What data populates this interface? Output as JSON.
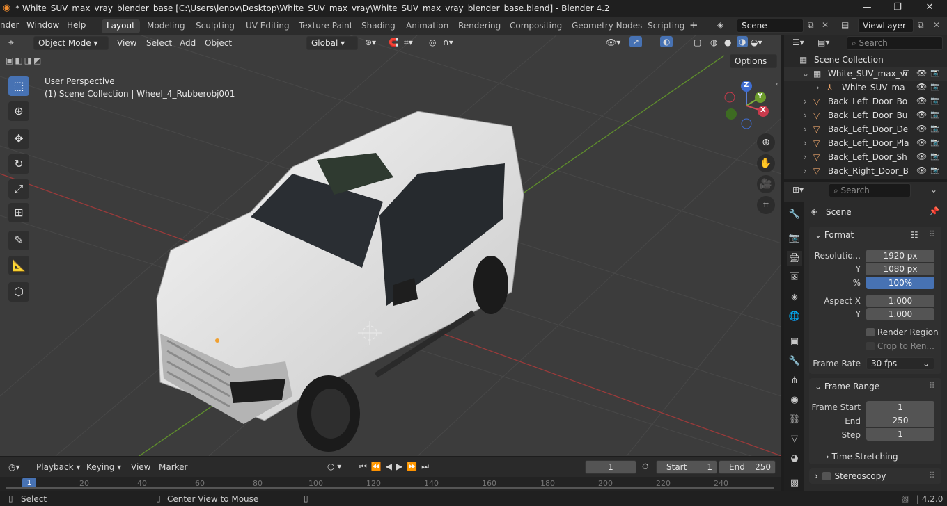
{
  "window": {
    "title": "* White_SUV_max_vray_blender_base [C:\\Users\\lenov\\Desktop\\White_SUV_max_vray\\White_SUV_max_vray_blender_base.blend] - Blender 4.2",
    "min": "—",
    "max": "❐",
    "close": "✕"
  },
  "menus": [
    "nder",
    "Window",
    "Help"
  ],
  "workspaces": [
    "Layout",
    "Modeling",
    "Sculpting",
    "UV Editing",
    "Texture Paint",
    "Shading",
    "Animation",
    "Rendering",
    "Compositing",
    "Geometry Nodes",
    "Scripting"
  ],
  "scene": {
    "name": "Scene",
    "viewlayer": "ViewLayer"
  },
  "viewport_header": {
    "mode": "Object Mode",
    "menus": [
      "View",
      "Select",
      "Add",
      "Object"
    ],
    "orientation": "Global",
    "options": "Options"
  },
  "viewport_info": {
    "perspective": "User Perspective",
    "collection": "(1) Scene Collection | Wheel_4_Rubberobj001"
  },
  "gizmo": {
    "z": "Z",
    "y": "Y",
    "x": "X"
  },
  "outliner": {
    "search_placeholder": "Search",
    "root": "Scene Collection",
    "items": [
      "White_SUV_max_vr",
      "White_SUV_ma",
      "Back_Left_Door_Bo",
      "Back_Left_Door_Bu",
      "Back_Left_Door_De",
      "Back_Left_Door_Pla",
      "Back_Left_Door_Sh",
      "Back_Right_Door_B"
    ]
  },
  "properties": {
    "search_placeholder": "Search",
    "context": "Scene",
    "format": {
      "title": "Format",
      "res_label": "Resolutio...",
      "res_x": "1920 px",
      "y_label": "Y",
      "res_y": "1080 px",
      "pct_label": "%",
      "pct": "100%",
      "aspect_label": "Aspect X",
      "aspect_x": "1.000",
      "aspect_y_label": "Y",
      "aspect_y": "1.000",
      "render_region": "Render Region",
      "crop": "Crop to Ren...",
      "framerate_label": "Frame Rate",
      "framerate": "30 fps"
    },
    "frame_range": {
      "title": "Frame Range",
      "start_label": "Frame Start",
      "start": "1",
      "end_label": "End",
      "end": "250",
      "step_label": "Step",
      "step": "1"
    },
    "time_stretching": "Time Stretching",
    "stereoscopy": "Stereoscopy"
  },
  "timeline": {
    "menus": [
      "Playback",
      "Keying",
      "View",
      "Marker"
    ],
    "current": "1",
    "start_label": "Start",
    "start": "1",
    "end_label": "End",
    "end": "250",
    "ticks": [
      "1",
      "20",
      "40",
      "60",
      "80",
      "100",
      "120",
      "140",
      "160",
      "180",
      "200",
      "220",
      "240"
    ]
  },
  "status": {
    "select": "Select",
    "center": "Center View to Mouse",
    "version": "4.2.0"
  }
}
